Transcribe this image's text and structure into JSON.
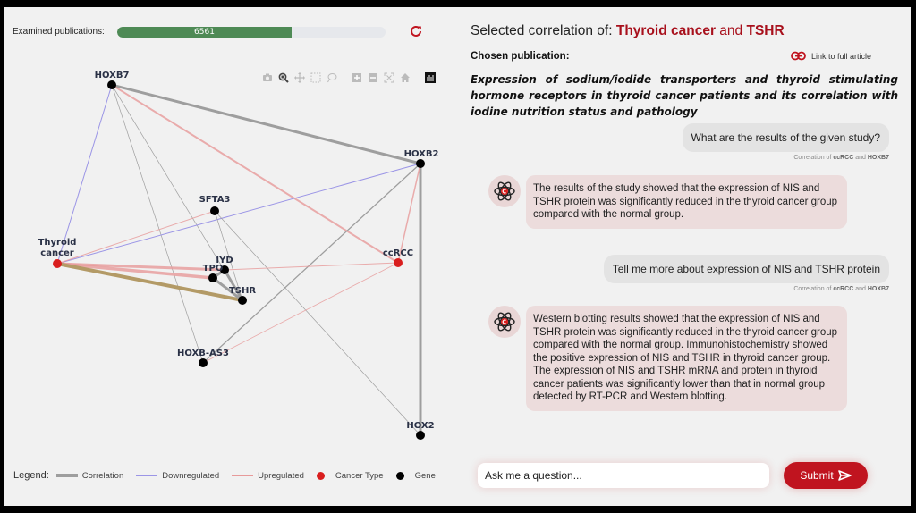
{
  "header": {
    "examined_label": "Examined publications:",
    "examined_count": "6561",
    "examined_progress_fraction": 0.65
  },
  "graph": {
    "toolbar_icons": [
      "camera-icon",
      "zoom-icon",
      "pan-icon",
      "box-select-icon",
      "lasso-icon",
      "zoom-in-icon",
      "zoom-out-icon",
      "autoscale-icon",
      "home-icon",
      "plotly-logo-icon"
    ],
    "nodes": [
      {
        "id": "HOXB7",
        "label": "HOXB7",
        "type": "gene"
      },
      {
        "id": "HOXB2",
        "label": "HOXB2",
        "type": "gene"
      },
      {
        "id": "SFTA3",
        "label": "SFTA3",
        "type": "gene"
      },
      {
        "id": "Thyroid cancer",
        "label": "Thyroid cancer",
        "type": "cancer"
      },
      {
        "id": "ccRCC",
        "label": "ccRCC",
        "type": "cancer"
      },
      {
        "id": "IYD",
        "label": "IYD",
        "type": "gene"
      },
      {
        "id": "TPO",
        "label": "TPO",
        "type": "gene"
      },
      {
        "id": "TSHR",
        "label": "TSHR",
        "type": "gene"
      },
      {
        "id": "HOXB-AS3",
        "label": "HOXB-AS3",
        "type": "gene"
      },
      {
        "id": "HOX2",
        "label": "HOX2",
        "type": "gene"
      }
    ],
    "edges": [
      {
        "s": "HOXB7",
        "t": "HOXB2",
        "kind": "correlation",
        "weight": 3
      },
      {
        "s": "HOXB7",
        "t": "ccRCC",
        "kind": "upregulated",
        "weight": 2
      },
      {
        "s": "HOXB7",
        "t": "Thyroid cancer",
        "kind": "downregulated",
        "weight": 1
      },
      {
        "s": "HOXB7",
        "t": "HOXB-AS3",
        "kind": "correlation",
        "weight": 0.7
      },
      {
        "s": "HOXB7",
        "t": "TSHR",
        "kind": "correlation",
        "weight": 0.7
      },
      {
        "s": "HOXB2",
        "t": "HOX2",
        "kind": "correlation",
        "weight": 3
      },
      {
        "s": "HOXB2",
        "t": "ccRCC",
        "kind": "upregulated",
        "weight": 1.5
      },
      {
        "s": "HOXB2",
        "t": "Thyroid cancer",
        "kind": "downregulated",
        "weight": 1
      },
      {
        "s": "HOXB2",
        "t": "HOXB-AS3",
        "kind": "correlation",
        "weight": 1.3
      },
      {
        "s": "SFTA3",
        "t": "Thyroid cancer",
        "kind": "upregulated",
        "weight": 1
      },
      {
        "s": "SFTA3",
        "t": "TSHR",
        "kind": "correlation",
        "weight": 0.7
      },
      {
        "s": "SFTA3",
        "t": "HOX2",
        "kind": "correlation",
        "weight": 0.7
      },
      {
        "s": "Thyroid cancer",
        "t": "IYD",
        "kind": "upregulated",
        "weight": 3
      },
      {
        "s": "Thyroid cancer",
        "t": "TPO",
        "kind": "upregulated",
        "weight": 3.5
      },
      {
        "s": "Thyroid cancer",
        "t": "TSHR",
        "kind": "selected",
        "weight": 4
      },
      {
        "s": "IYD",
        "t": "ccRCC",
        "kind": "upregulated",
        "weight": 1
      },
      {
        "s": "IYD",
        "t": "TSHR",
        "kind": "correlation",
        "weight": 3
      },
      {
        "s": "TPO",
        "t": "TSHR",
        "kind": "correlation",
        "weight": 3
      },
      {
        "s": "TPO",
        "t": "IYD",
        "kind": "correlation",
        "weight": 3
      },
      {
        "s": "ccRCC",
        "t": "HOXB-AS3",
        "kind": "upregulated",
        "weight": 0.8
      }
    ]
  },
  "legend": {
    "title": "Legend:",
    "items": [
      {
        "label": "Correlation",
        "kind": "line-thick",
        "color": "#9e9e9e"
      },
      {
        "label": "Downregulated",
        "kind": "line",
        "color": "#9b95e6"
      },
      {
        "label": "Upregulated",
        "kind": "line",
        "color": "#e79a9a"
      },
      {
        "label": "Cancer Type",
        "kind": "dot",
        "color": "#d91e1e"
      },
      {
        "label": "Gene",
        "kind": "dot",
        "color": "#000000"
      }
    ]
  },
  "right": {
    "selected_prefix": "Selected correlation of:",
    "selected_a": "Thyroid cancer",
    "selected_and": "and",
    "selected_b": "TSHR",
    "chosen_label": "Chosen publication:",
    "link_label": "Link to full article",
    "publication_title": "Expression of sodium/iodide transporters and thyroid stimulating hormone receptors in thyroid cancer patients and its correlation with iodine nutrition status and pathology",
    "messages": [
      {
        "role": "user",
        "text": "What are the results of the given study?",
        "meta_prefix": "Correlation of",
        "meta_a": "ccRCC",
        "meta_and": "and",
        "meta_b": "HOXB7"
      },
      {
        "role": "bot",
        "text": "The results of the study showed that the expression of NIS and TSHR protein was significantly reduced in the thyroid cancer group compared with the normal group."
      },
      {
        "role": "user",
        "text": "Tell me more about expression of NIS and TSHR protein",
        "meta_prefix": "Correlation of",
        "meta_a": "ccRCC",
        "meta_and": "and",
        "meta_b": "HOXB7"
      },
      {
        "role": "bot",
        "text": "Western blotting results showed that the expression of NIS and TSHR protein was significantly reduced in the thyroid cancer group compared with the normal group. Immunohistochemistry showed the positive expression of NIS and TSHR in thyroid cancer group. The expression of NIS and TSHR mRNA and protein in thyroid cancer patients was significantly lower than that in normal group detected by RT-PCR and Western blotting."
      }
    ],
    "input_placeholder": "Ask me a question...",
    "submit_label": "Submit"
  },
  "colors": {
    "accent": "#c0141f",
    "progress": "#4e8a55",
    "correlation": "#9e9e9e",
    "downregulated": "#9b95e6",
    "upregulated": "#e79a9a",
    "selected_edge": "#b39a66",
    "cancer": "#d91e1e",
    "gene": "#000000"
  }
}
